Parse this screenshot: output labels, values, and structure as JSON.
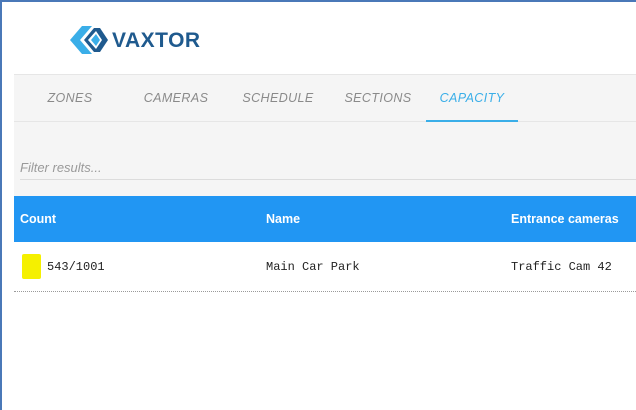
{
  "brand": {
    "name": "VAXTOR",
    "logo_icon": "vaxtor-diamond-logo-icon",
    "colors": {
      "dark": "#1f5a8e",
      "light": "#3aaee8"
    }
  },
  "nav": {
    "tabs": [
      {
        "label": "ZONES",
        "active": false
      },
      {
        "label": "CAMERAS",
        "active": false
      },
      {
        "label": "SCHEDULE",
        "active": false
      },
      {
        "label": "SECTIONS",
        "active": false
      },
      {
        "label": "CAPACITY",
        "active": true
      }
    ],
    "active_color": "#3aaee8"
  },
  "filter": {
    "placeholder": "Filter results...",
    "value": ""
  },
  "table": {
    "header_color": "#2196f3",
    "columns": [
      "Count",
      "Name",
      "Entrance cameras"
    ],
    "rows": [
      {
        "status_color": "#f5f000",
        "count": "543/1001",
        "name": "Main Car Park",
        "entrance_cameras": "Traffic Cam 42"
      }
    ]
  }
}
